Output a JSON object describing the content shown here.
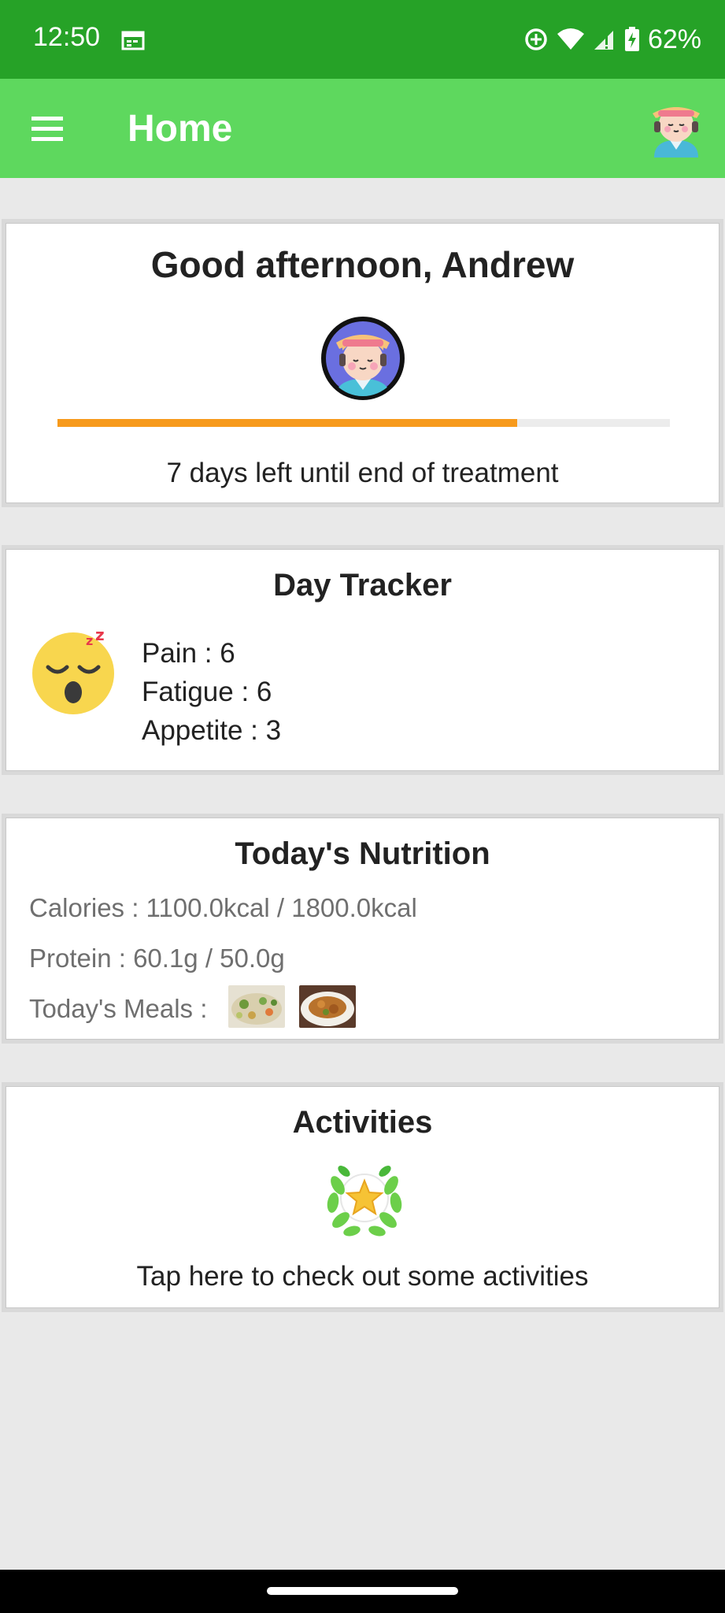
{
  "status_bar": {
    "time": "12:50",
    "battery": "62%",
    "icons": [
      "calendar-icon",
      "data-saver-icon",
      "wifi-icon",
      "signal-icon",
      "battery-icon"
    ]
  },
  "app_bar": {
    "title": "Home",
    "menu_icon": "hamburger-menu-icon",
    "avatar_icon": "user-avatar-icon",
    "color": "#5ed85e"
  },
  "greeting_card": {
    "title": "Good afternoon, Andrew",
    "treatment_text": "7 days left until end of treatment",
    "progress_fraction": 0.75,
    "progress_color": "#f79a1c"
  },
  "day_tracker": {
    "title": "Day Tracker",
    "mood_icon": "sleepy-face-icon",
    "items": [
      {
        "label": "Pain : 6"
      },
      {
        "label": "Fatigue : 6"
      },
      {
        "label": "Appetite : 3"
      }
    ]
  },
  "nutrition": {
    "title": "Today's Nutrition",
    "calories": "Calories : 1100.0kcal / 1800.0kcal",
    "protein": "Protein : 60.1g / 50.0g",
    "meals_label": "Today's Meals :",
    "meals": [
      "pasta-salad-photo",
      "chicken-dish-photo"
    ]
  },
  "activities": {
    "title": "Activities",
    "icon": "laurel-star-icon",
    "text": "Tap here to check out some activities"
  },
  "theme": {
    "status_bar_color": "#26a227",
    "background": "#e9e9e9"
  }
}
